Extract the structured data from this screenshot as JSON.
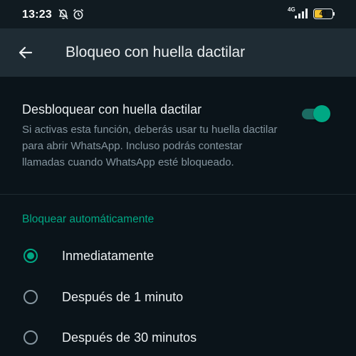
{
  "status_bar": {
    "time": "13:23",
    "network_type": "4G",
    "battery_level": "41",
    "icons": [
      "bell-off-icon",
      "alarm-icon",
      "signal-icon",
      "battery-icon"
    ]
  },
  "app_bar": {
    "back_icon": "arrow-left-icon",
    "title": "Bloqueo con huella dactilar"
  },
  "fingerprint_setting": {
    "title": "Desbloquear con huella dactilar",
    "description": "Si activas esta función, deberás usar tu huella dactilar para abrir WhatsApp. Incluso podrás contestar llamadas cuando WhatsApp esté bloqueado.",
    "enabled": true
  },
  "auto_lock": {
    "section_title": "Bloquear automáticamente",
    "options": [
      {
        "label": "Inmediatamente",
        "selected": true
      },
      {
        "label": "Después de 1 minuto",
        "selected": false
      },
      {
        "label": "Después de 30 minutos",
        "selected": false
      }
    ]
  },
  "colors": {
    "accent": "#00a884",
    "background": "#0b141a",
    "app_bar": "#1f2c34",
    "secondary_text": "#8696a0"
  }
}
